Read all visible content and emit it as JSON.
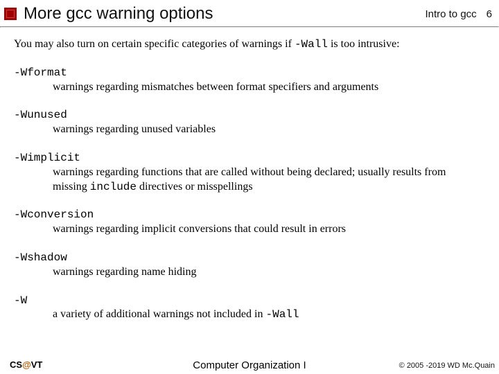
{
  "header": {
    "title": "More gcc warning options",
    "course": "Intro to gcc",
    "page": "6"
  },
  "intro": {
    "pre": "You may also turn on certain specific categories of warnings if ",
    "code": "-Wall",
    "post": " is too intrusive:"
  },
  "options": [
    {
      "flag": "-Wformat",
      "desc_pre": "warnings regarding mismatches between format specifiers and arguments",
      "code": "",
      "desc_post": ""
    },
    {
      "flag": "-Wunused",
      "desc_pre": "warnings regarding unused variables",
      "code": "",
      "desc_post": ""
    },
    {
      "flag": "-Wimplicit",
      "desc_pre": "warnings regarding functions that are called without being declared; usually results from missing ",
      "code": "include",
      "desc_post": " directives or misspellings"
    },
    {
      "flag": "-Wconversion",
      "desc_pre": "warnings regarding implicit conversions that could result in errors",
      "code": "",
      "desc_post": ""
    },
    {
      "flag": "-Wshadow",
      "desc_pre": "warnings regarding name hiding",
      "code": "",
      "desc_post": ""
    },
    {
      "flag": "-W",
      "desc_pre": "a variety of additional warnings not included in ",
      "code": "-Wall",
      "desc_post": ""
    }
  ],
  "footer": {
    "left_cs": "CS",
    "left_at": "@",
    "left_vt": "VT",
    "center": "Computer Organization I",
    "right": "© 2005 -2019 WD Mc.Quain"
  }
}
